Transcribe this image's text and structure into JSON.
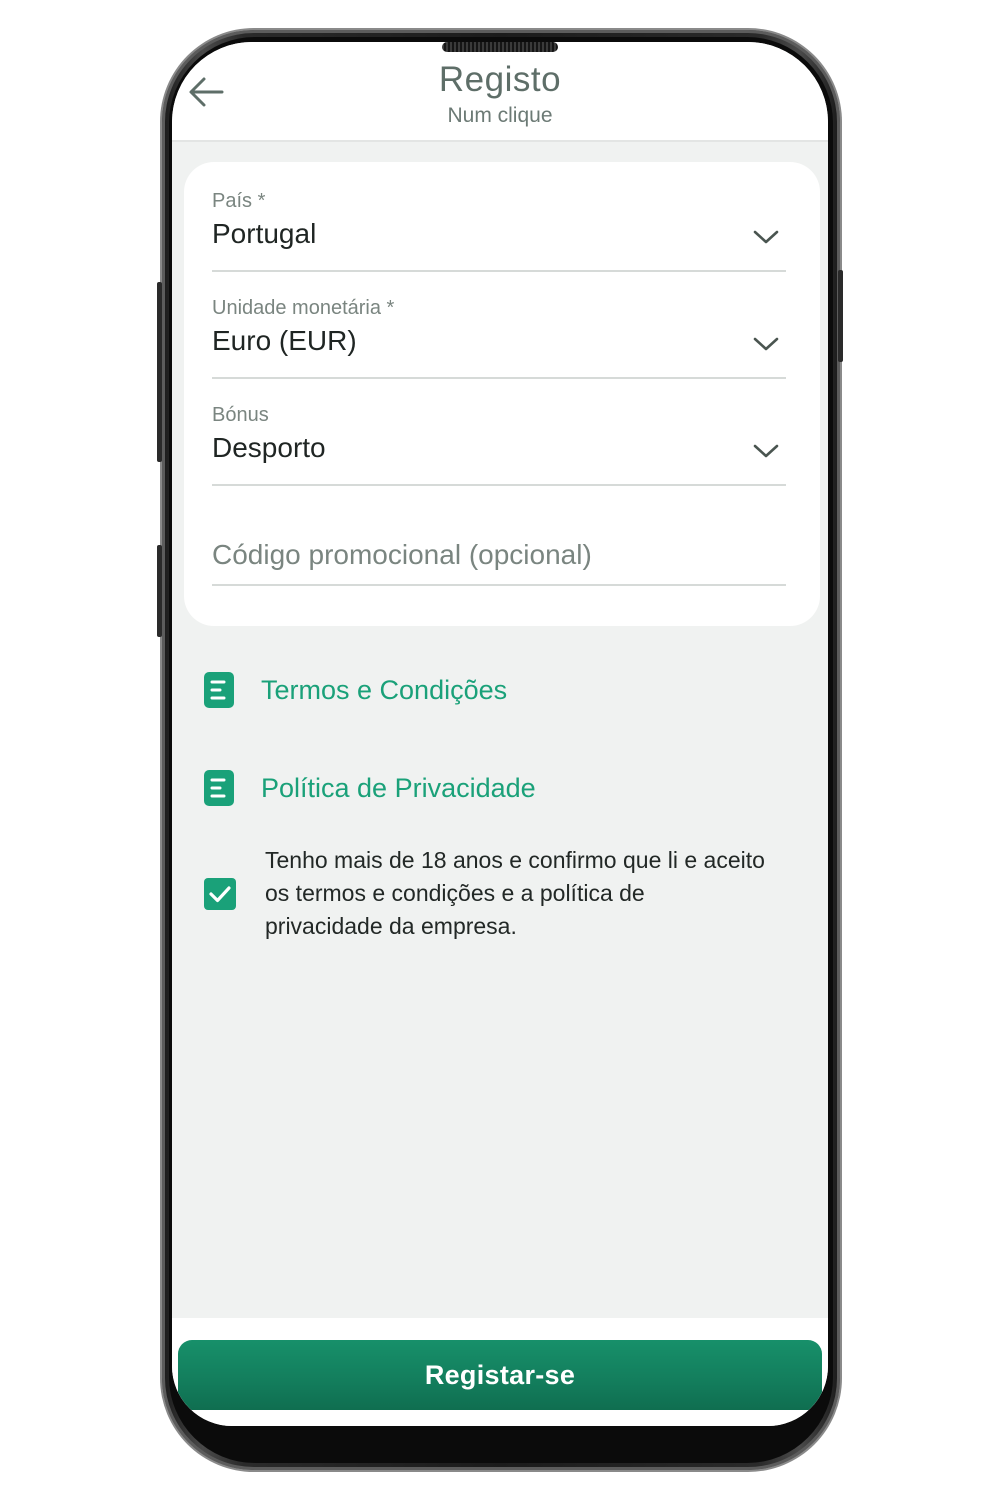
{
  "header": {
    "title": "Registo",
    "subtitle": "Num clique",
    "back_icon": "arrow-left-icon"
  },
  "form": {
    "country": {
      "label": "País *",
      "value": "Portugal"
    },
    "currency": {
      "label": "Unidade monetária *",
      "value": "Euro (EUR)"
    },
    "bonus": {
      "label": "Bónus",
      "value": "Desporto"
    },
    "promo_code": {
      "placeholder": "Código promocional (opcional)",
      "value": ""
    }
  },
  "links": {
    "terms": "Termos e Condições",
    "privacy": "Política de Privacidade",
    "icon": "document-icon"
  },
  "consent": {
    "checked": true,
    "text": "Tenho mais de 18 anos e confirmo que li e aceito os termos e condições e a política de privacidade da empresa."
  },
  "actions": {
    "register_label": "Registar-se"
  },
  "colors": {
    "accent": "#1aa179",
    "button": "#137d5c",
    "background": "#f0f2f1",
    "title": "#5e6e68"
  }
}
